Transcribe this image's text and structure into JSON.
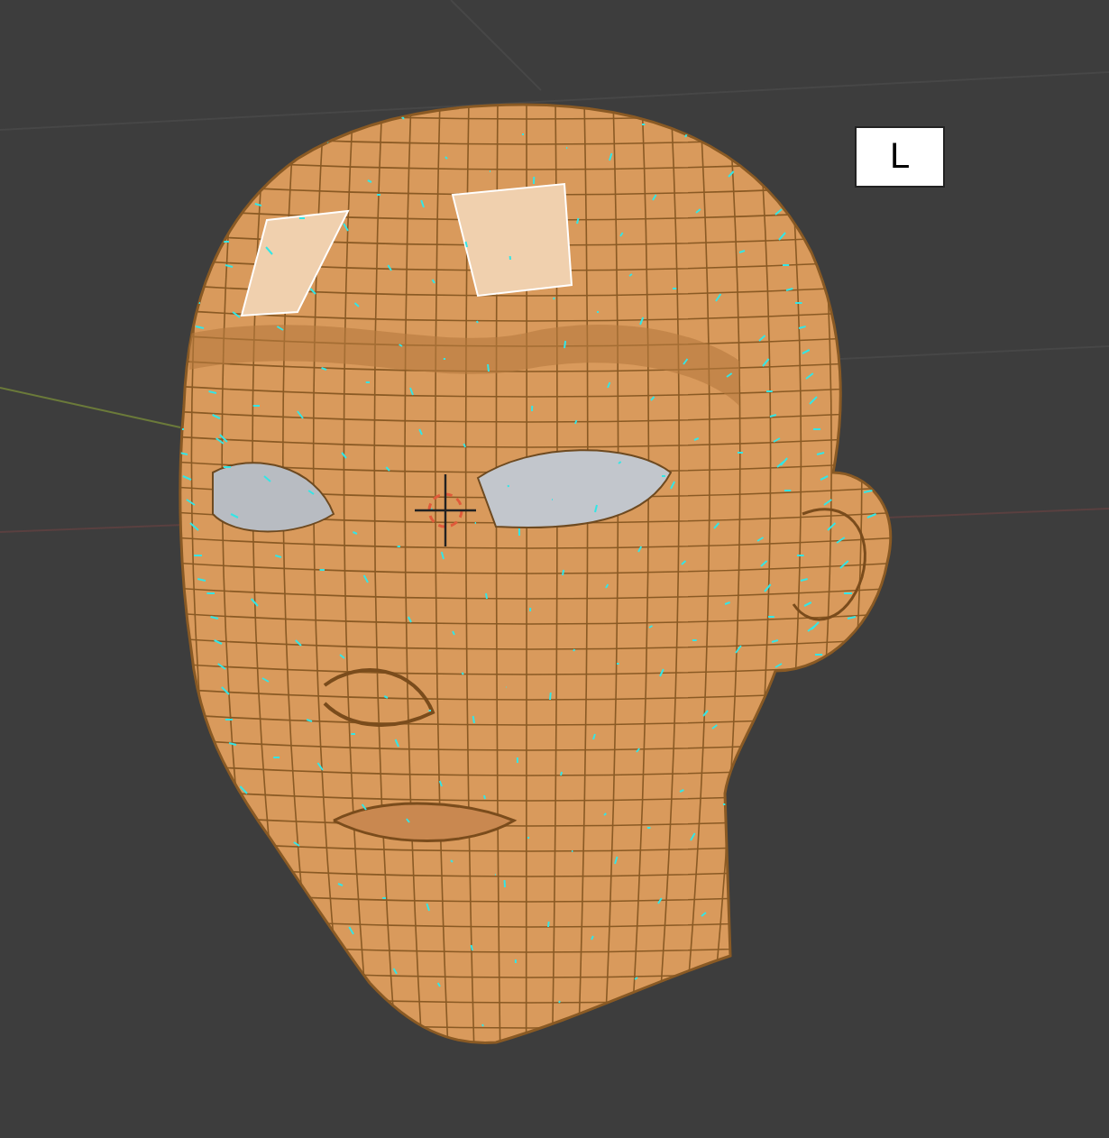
{
  "key_overlay": {
    "label": "L"
  }
}
